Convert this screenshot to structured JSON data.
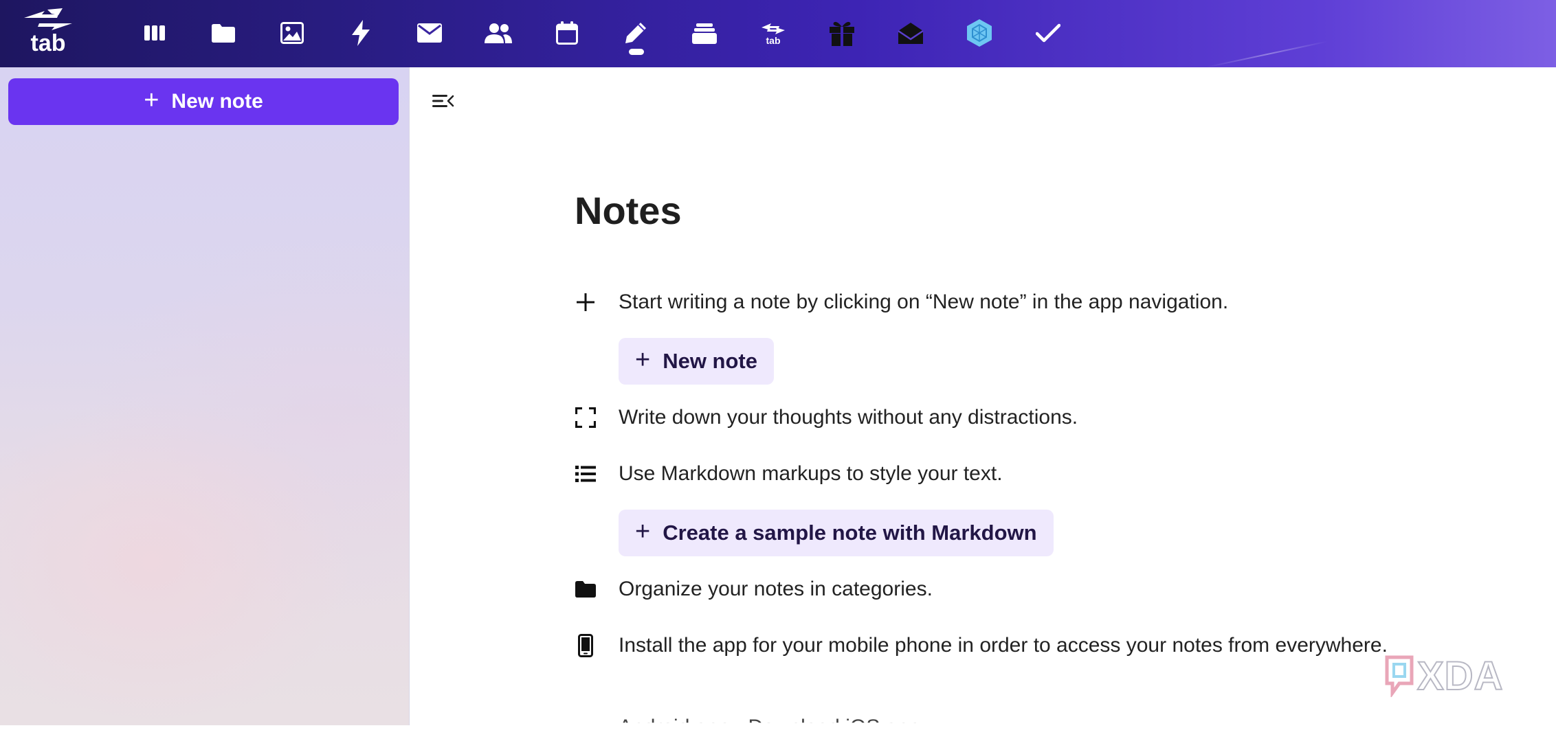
{
  "app": {
    "logo_text": "tab"
  },
  "nav": {
    "icons": [
      {
        "name": "columns-icon"
      },
      {
        "name": "folder-icon"
      },
      {
        "name": "image-icon"
      },
      {
        "name": "bolt-icon"
      },
      {
        "name": "mail-icon"
      },
      {
        "name": "contacts-icon"
      },
      {
        "name": "calendar-icon"
      },
      {
        "name": "pencil-icon",
        "active": true
      },
      {
        "name": "layers-icon"
      },
      {
        "name": "tab-transfer-icon"
      },
      {
        "name": "gift-icon"
      },
      {
        "name": "envelope-open-icon"
      },
      {
        "name": "hexagon-icon"
      },
      {
        "name": "check-icon"
      }
    ]
  },
  "sidebar": {
    "new_note_label": "New note"
  },
  "main": {
    "title": "Notes",
    "rows": [
      {
        "icon": "plus-icon",
        "text": "Start writing a note by clicking on “New note” in the app navigation."
      },
      {
        "icon": "fullscreen-icon",
        "text": "Write down your thoughts without any distractions."
      },
      {
        "icon": "list-icon",
        "text": "Use Markdown markups to style your text."
      },
      {
        "icon": "folder-icon",
        "text": "Organize your notes in categories."
      },
      {
        "icon": "mobile-phone-icon",
        "text": "Install the app for your mobile phone in order to access your notes from everywhere."
      }
    ],
    "new_note_button": "New note",
    "sample_note_button": "Create a sample note with Markdown",
    "cutoff_text": "Android app  ·  Download iOS app"
  },
  "colors": {
    "accent": "#6a34f0",
    "topbar_start": "#1e1660",
    "topbar_end": "#7d5fe4",
    "action_bg": "#efe9fd",
    "text": "#222222"
  },
  "watermark": {
    "text": "XDA"
  }
}
